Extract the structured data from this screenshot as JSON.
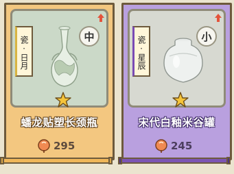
{
  "cards": [
    {
      "category": "瓷·日月",
      "size": "中",
      "name": "蟠龙贴塑长颈瓶",
      "price": "295",
      "item_icon": "long-neck-vase",
      "theme": {
        "bg": "#f3c780",
        "frame": "#cbd9c8",
        "accent": "#d9b441"
      }
    },
    {
      "category": "瓷·星辰",
      "size": "小",
      "name": "宋代白釉米谷罐",
      "price": "245",
      "item_icon": "round-jar",
      "theme": {
        "bg": "#b9a0df",
        "frame": "#d7d9d1",
        "accent": "#7a4bb4"
      }
    }
  ]
}
